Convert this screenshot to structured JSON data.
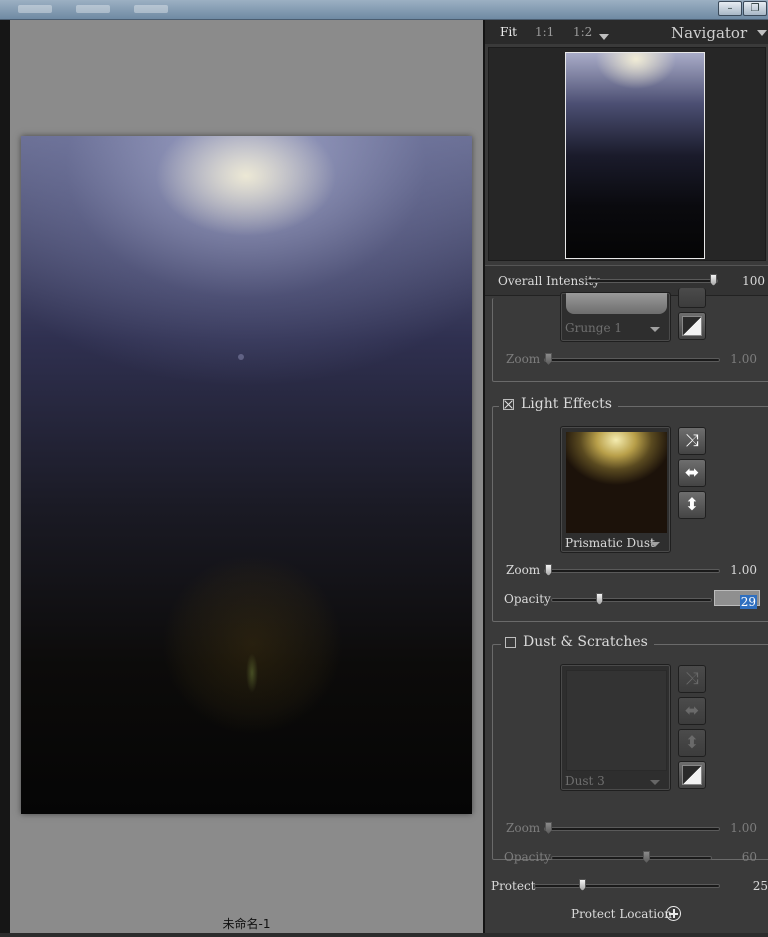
{
  "document": {
    "title": "未命名-1"
  },
  "navigator": {
    "zoom_fit": "Fit",
    "zoom_1_1": "1:1",
    "zoom_1_2": "1:2",
    "title": "Navigator"
  },
  "overall_intensity": {
    "label": "Overall Intensity",
    "value": "100",
    "level": 1.0
  },
  "texture_section": {
    "preset_name": "Grunge  1",
    "zoom_label": "Zoom",
    "zoom_value": "1.00",
    "zoom_level": 0.0
  },
  "light_effects": {
    "title": "Light Effects",
    "enabled": true,
    "preset_name": "Prismatic Dust",
    "zoom_label": "Zoom",
    "zoom_value": "1.00",
    "zoom_level": 0.0,
    "opacity_label": "Opacity",
    "opacity_value": "29",
    "opacity_level": 0.29,
    "tools": [
      "shuffle-icon",
      "flip-horizontal-icon",
      "flip-vertical-icon"
    ]
  },
  "dust_scratches": {
    "title": "Dust & Scratches",
    "enabled": false,
    "preset_name": "Dust  3",
    "zoom_label": "Zoom",
    "zoom_value": "1.00",
    "zoom_level": 0.0,
    "opacity_label": "Opacity",
    "opacity_value": "60",
    "opacity_level": 0.6,
    "tools": [
      "shuffle-icon",
      "flip-horizontal-icon",
      "flip-vertical-icon",
      "invert-icon"
    ]
  },
  "protect": {
    "label": "Protect",
    "value": "25",
    "level": 0.25
  },
  "protect_location": {
    "label": "Protect Location:"
  },
  "colors": {
    "panel": "#3a3a3a",
    "canvas_bg": "#8b8b8b",
    "selection": "#2f6fbf"
  }
}
